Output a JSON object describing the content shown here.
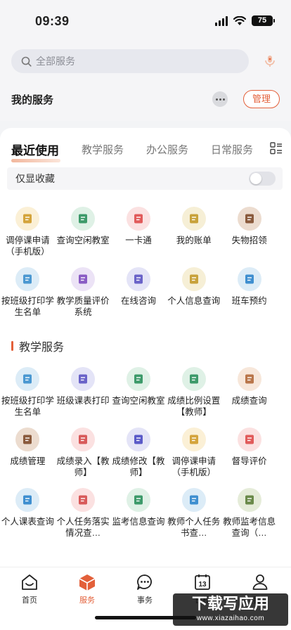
{
  "status_bar": {
    "time": "09:39",
    "battery": "75"
  },
  "header": {
    "search_placeholder": "全部服务",
    "my_services_title": "我的服务",
    "manage_label": "管理"
  },
  "tabs": [
    {
      "label": "最近使用",
      "active": true
    },
    {
      "label": "教学服务",
      "active": false
    },
    {
      "label": "办公服务",
      "active": false
    },
    {
      "label": "日常服务",
      "active": false
    }
  ],
  "favorites_only": {
    "label": "仅显收藏",
    "enabled": false
  },
  "recent_items": [
    {
      "label": "调停课申请（手机版）",
      "icon": "document-form-icon",
      "bg": "#fbf0d6",
      "fg": "#d4a43c"
    },
    {
      "label": "查询空闲教室",
      "icon": "classroom-board-icon",
      "bg": "#dff1e6",
      "fg": "#3d9a6a"
    },
    {
      "label": "一卡通",
      "icon": "id-card-icon",
      "bg": "#fbe1e1",
      "fg": "#e15b5b"
    },
    {
      "label": "我的账单",
      "icon": "bill-icon",
      "bg": "#f6efd6",
      "fg": "#c8a23b"
    },
    {
      "label": "失物招领",
      "icon": "box-icon",
      "bg": "#ecdccf",
      "fg": "#8a5a3c"
    },
    {
      "label": "按班级打印学生名单",
      "icon": "printer-icon",
      "bg": "#dcecf7",
      "fg": "#4b98d1"
    },
    {
      "label": "教学质量评价系统",
      "icon": "presentation-icon",
      "bg": "#ece3f6",
      "fg": "#8a5cc4"
    },
    {
      "label": "在线咨询",
      "icon": "consult-icon",
      "bg": "#e4e4f7",
      "fg": "#6a63c8"
    },
    {
      "label": "个人信息查询",
      "icon": "personal-info-icon",
      "bg": "#f6efd6",
      "fg": "#c8a23b"
    },
    {
      "label": "班车预约",
      "icon": "bus-icon",
      "bg": "#dcecf7",
      "fg": "#3f8fd0"
    }
  ],
  "teaching_section_title": "教学服务",
  "teaching_items": [
    {
      "label": "按班级打印学生名单",
      "icon": "printer-icon",
      "bg": "#dcecf7",
      "fg": "#4b98d1"
    },
    {
      "label": "班级课表打印",
      "icon": "schedule-icon",
      "bg": "#e4e4f7",
      "fg": "#6a63c8"
    },
    {
      "label": "查询空闲教室",
      "icon": "classroom-board-icon",
      "bg": "#dff1e6",
      "fg": "#3d9a6a"
    },
    {
      "label": "成绩比例设置【教师】",
      "icon": "grade-ratio-icon",
      "bg": "#dff1e6",
      "fg": "#3d9a6a"
    },
    {
      "label": "成绩查询",
      "icon": "calendar-icon",
      "bg": "#f7e7da",
      "fg": "#b9764a"
    },
    {
      "label": "成绩管理",
      "icon": "ledger-icon",
      "bg": "#ecdccf",
      "fg": "#8a5a3c"
    },
    {
      "label": "成绩录入【教师】",
      "icon": "grade-entry-icon",
      "bg": "#fbe1e1",
      "fg": "#d85a5a"
    },
    {
      "label": "成绩修改【教师】",
      "icon": "grade-edit-icon",
      "bg": "#e4e4f7",
      "fg": "#5a5ac8"
    },
    {
      "label": "调停课申请（手机版）",
      "icon": "document-form-icon",
      "bg": "#fbf0d6",
      "fg": "#d4a43c"
    },
    {
      "label": "督导评价",
      "icon": "supervision-icon",
      "bg": "#fbe1e1",
      "fg": "#e15b5b"
    },
    {
      "label": "个人课表查询",
      "icon": "timetable-icon",
      "bg": "#dcecf7",
      "fg": "#3f8fd0"
    },
    {
      "label": "个人任务落实情况查…",
      "icon": "task-icon",
      "bg": "#fbe1e1",
      "fg": "#d85a5a"
    },
    {
      "label": "监考信息查询",
      "icon": "exam-download-icon",
      "bg": "#dff1e6",
      "fg": "#3d9a6a"
    },
    {
      "label": "教师个人任务书查…",
      "icon": "task-book-icon",
      "bg": "#dcecf7",
      "fg": "#3f8fd0"
    },
    {
      "label": "教师监考信息查询（…",
      "icon": "invigilator-icon",
      "bg": "#e5ecd9",
      "fg": "#6a8a4a"
    }
  ],
  "bottom_tabs": [
    {
      "label": "首页",
      "icon": "home-icon",
      "active": false
    },
    {
      "label": "服务",
      "icon": "service-cube-icon",
      "active": true
    },
    {
      "label": "事务",
      "icon": "chat-icon",
      "active": false
    },
    {
      "label": "日程",
      "icon": "calendar-13-icon",
      "active": false
    },
    {
      "label": "我的",
      "icon": "user-icon",
      "active": false
    }
  ],
  "calendar_icon_day": "13",
  "watermark": {
    "title": "下载写应用",
    "site": "www.xiazaihao.com"
  },
  "colors": {
    "accent": "#e3603a"
  }
}
